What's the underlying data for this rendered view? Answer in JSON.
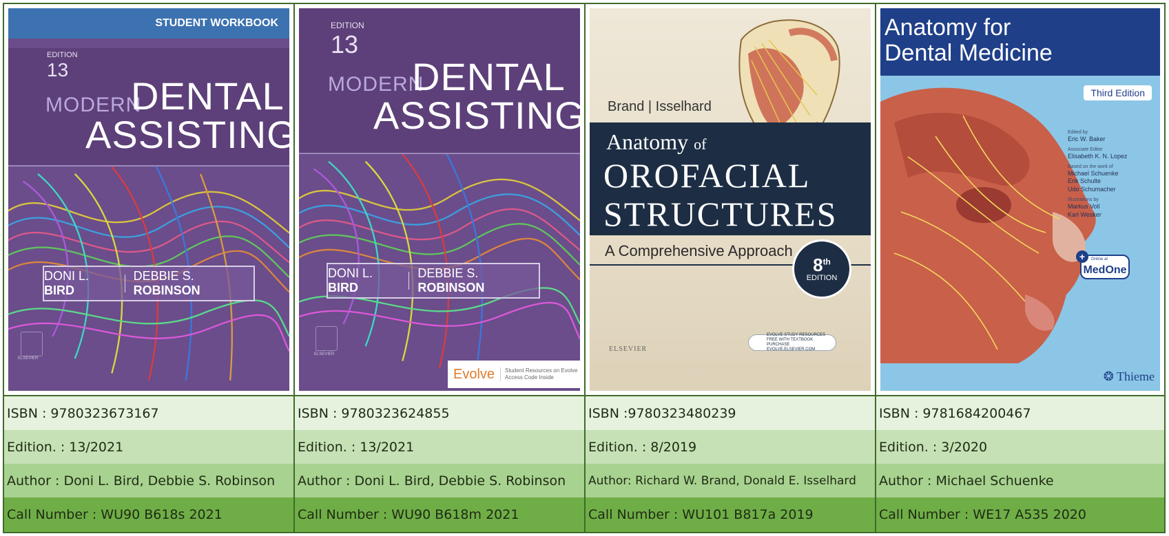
{
  "books": [
    {
      "cover": {
        "banner": "STUDENT WORKBOOK",
        "edition_label": "EDITION",
        "edition_number": "13",
        "title_small": "MODERN",
        "title_line1": "DENTAL",
        "title_line2": "ASSISTING",
        "author1_first": "DONI L.",
        "author1_last": "BIRD",
        "author2_first": "DEBBIE S.",
        "author2_last": "ROBINSON",
        "publisher": "ELSEVIER"
      },
      "isbn": "ISBN : 9780323673167",
      "edition": "Edition. : 13/2021",
      "author": "Author :  Doni L. Bird, Debbie S. Robinson",
      "call_number": "Call Number : WU90 B618s 2021"
    },
    {
      "cover": {
        "edition_label": "EDITION",
        "edition_number": "13",
        "title_small": "MODERN",
        "title_line1": "DENTAL",
        "title_line2": "ASSISTING",
        "author1_first": "DONI L.",
        "author1_last": "BIRD",
        "author2_first": "DEBBIE S.",
        "author2_last": "ROBINSON",
        "evolve": "Evolve",
        "evolve_sub1": "Student Resources on Evolve",
        "evolve_sub2": "Access Code Inside",
        "publisher": "ELSEVIER"
      },
      "isbn": "ISBN : 9780323624855",
      "edition": "Edition. : 13/2021",
      "author": "Author : Doni L. Bird, Debbie S. Robinson",
      "call_number": "Call Number : WU90 B618m 2021"
    },
    {
      "cover": {
        "brand": "Brand | Isselhard",
        "title_a": "Anatomy",
        "title_of": "of",
        "title_line1": "OROFACIAL",
        "title_line2": "STRUCTURES",
        "subtitle": "A Comprehensive Approach",
        "edition_number": "8",
        "edition_suffix": "th",
        "edition_label": "EDITION",
        "pill_line1": "EVOLVE STUDY RESOURCES",
        "pill_line2": "FREE WITH TEXTBOOK PURCHASE",
        "pill_line3": "EVOLVE.ELSEVIER.COM",
        "publisher": "ELSEVIER"
      },
      "isbn": "ISBN :9780323480239",
      "edition": "Edition. :  8/2019",
      "author": "Author: Richard W. Brand, Donald E. Isselhard",
      "call_number": "Call Number : WU101 B817a 2019"
    },
    {
      "cover": {
        "title_line1": "Anatomy for",
        "title_line2": "Dental Medicine",
        "edition_badge": "Third Edition",
        "edited_by": "Edited by",
        "editor": "Eric W. Baker",
        "assoc_label": "Associate Editor",
        "assoc_editor": "Elisabeth K. N. Lopez",
        "based_on": "Based on the work of",
        "based1": "Michael Schuenke",
        "based2": "Erik Schulte",
        "based3": "Udo Schumacher",
        "illus_label": "Illustrations by",
        "illus1": "Markus Voll",
        "illus2": "Karl Wesker",
        "online_at": "Online at",
        "medone": "MedOne",
        "publisher": "Thieme"
      },
      "isbn": "ISBN : 9781684200467",
      "edition": "Edition. :  3/2020",
      "author": "Author : Michael Schuenke",
      "call_number": "Call Number : WE17 A535 2020"
    }
  ],
  "colors": {
    "border": "#3f6b2a",
    "row1": "#e6f2dd",
    "row2": "#c6e1b5",
    "row3": "#a8d28f",
    "row4": "#6fae46",
    "purple": "#6a4d8a",
    "navy": "#1d2e44",
    "thieme_blue": "#1f3f88"
  }
}
